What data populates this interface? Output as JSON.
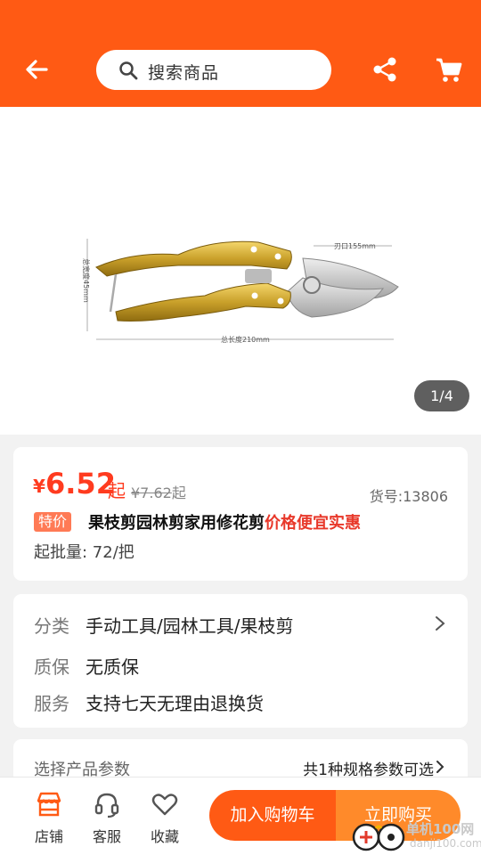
{
  "header": {
    "back_icon": "arrow-left-icon",
    "search_placeholder": "搜索商品",
    "share_icon": "share-icon",
    "cart_icon": "shopping-cart-icon",
    "bg_color": "#ff5a14"
  },
  "gallery": {
    "pager": "1/4",
    "image_labels": {
      "blade": "刃口155mm",
      "width": "总宽度45mm",
      "length": "总长度210mm"
    }
  },
  "product": {
    "price_symbol": "¥",
    "price": "6.52",
    "price_suffix": "起",
    "original_price": "¥7.62",
    "original_suffix": "起",
    "sku": "货号:13806",
    "tag": "特价",
    "title_main": "果枝剪园林剪家用修花剪",
    "title_highlight": "价格便宜实惠",
    "moq": "起批量: 72/把"
  },
  "info": {
    "category_key": "分类",
    "category_value": "手动工具/园林工具/果枝剪",
    "warranty_key": "质保",
    "warranty_value": "无质保",
    "service_key": "服务",
    "service_value": "支持七天无理由退换货"
  },
  "params": {
    "label": "选择产品参数",
    "value": "共1种规格参数可选"
  },
  "bottom_bar": {
    "store": "店铺",
    "service": "客服",
    "favorite": "收藏",
    "add_to_cart": "加入购物车",
    "buy_now": "立即购买",
    "accent": "#ff5a14"
  },
  "watermark": {
    "brand": "单机100网",
    "url": "danji100.com"
  }
}
